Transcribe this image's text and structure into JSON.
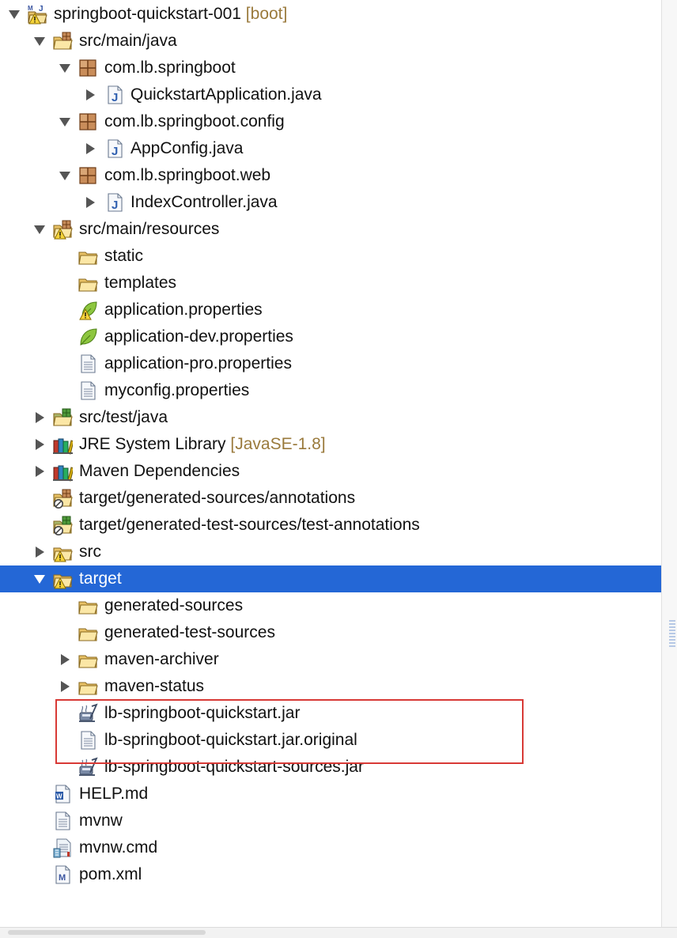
{
  "tree": [
    {
      "label": "springboot-quickstart-001",
      "decoration": "[boot]",
      "icon": "maven-project-icon",
      "expanded": true
    },
    {
      "label": "src/main/java",
      "icon": "source-folder-icon",
      "expanded": true
    },
    {
      "label": "com.lb.springboot",
      "icon": "package-icon",
      "expanded": true
    },
    {
      "label": "QuickstartApplication.java",
      "icon": "java-file-icon",
      "expanded": false
    },
    {
      "label": "com.lb.springboot.config",
      "icon": "package-icon",
      "expanded": true
    },
    {
      "label": "AppConfig.java",
      "icon": "java-file-icon",
      "expanded": false
    },
    {
      "label": "com.lb.springboot.web",
      "icon": "package-icon",
      "expanded": true
    },
    {
      "label": "IndexController.java",
      "icon": "java-file-icon",
      "expanded": false
    },
    {
      "label": "src/main/resources",
      "icon": "source-folder-warning-icon",
      "expanded": true
    },
    {
      "label": "static",
      "icon": "folder-icon",
      "expanded": null
    },
    {
      "label": "templates",
      "icon": "folder-icon",
      "expanded": null
    },
    {
      "label": "application.properties",
      "icon": "spring-properties-warning-icon",
      "expanded": null
    },
    {
      "label": "application-dev.properties",
      "icon": "spring-properties-icon",
      "expanded": null
    },
    {
      "label": "application-pro.properties",
      "icon": "text-file-icon",
      "expanded": null
    },
    {
      "label": "myconfig.properties",
      "icon": "text-file-icon",
      "expanded": null
    },
    {
      "label": "src/test/java",
      "icon": "test-source-folder-icon",
      "expanded": false
    },
    {
      "label": "JRE System Library",
      "decoration": "[JavaSE-1.8]",
      "icon": "library-icon",
      "expanded": false
    },
    {
      "label": "Maven Dependencies",
      "icon": "library-icon",
      "expanded": false
    },
    {
      "label": "target/generated-sources/annotations",
      "icon": "source-folder-ignored-icon",
      "expanded": null
    },
    {
      "label": "target/generated-test-sources/test-annotations",
      "icon": "test-source-folder-ignored-icon",
      "expanded": null
    },
    {
      "label": "src",
      "icon": "folder-warning-icon",
      "expanded": false
    },
    {
      "label": "target",
      "icon": "folder-warning-icon",
      "expanded": true,
      "selected": true
    },
    {
      "label": "generated-sources",
      "icon": "folder-icon",
      "expanded": null
    },
    {
      "label": "generated-test-sources",
      "icon": "folder-icon",
      "expanded": null
    },
    {
      "label": "maven-archiver",
      "icon": "folder-icon",
      "expanded": false
    },
    {
      "label": "maven-status",
      "icon": "folder-icon",
      "expanded": false
    },
    {
      "label": "lb-springboot-quickstart.jar",
      "icon": "jar-file-icon",
      "expanded": null
    },
    {
      "label": "lb-springboot-quickstart.jar.original",
      "icon": "text-file-icon",
      "expanded": null
    },
    {
      "label": "lb-springboot-quickstart-sources.jar",
      "icon": "jar-file-icon",
      "expanded": null
    },
    {
      "label": "HELP.md",
      "icon": "word-doc-icon",
      "expanded": null
    },
    {
      "label": "mvnw",
      "icon": "text-file-icon",
      "expanded": null
    },
    {
      "label": "mvnw.cmd",
      "icon": "script-file-icon",
      "expanded": null
    },
    {
      "label": "pom.xml",
      "icon": "maven-pom-icon",
      "expanded": null
    }
  ],
  "colors": {
    "selection": "#2467d6",
    "highlight_box": "#d83a36",
    "decoration_text": "#9a7a3c"
  }
}
